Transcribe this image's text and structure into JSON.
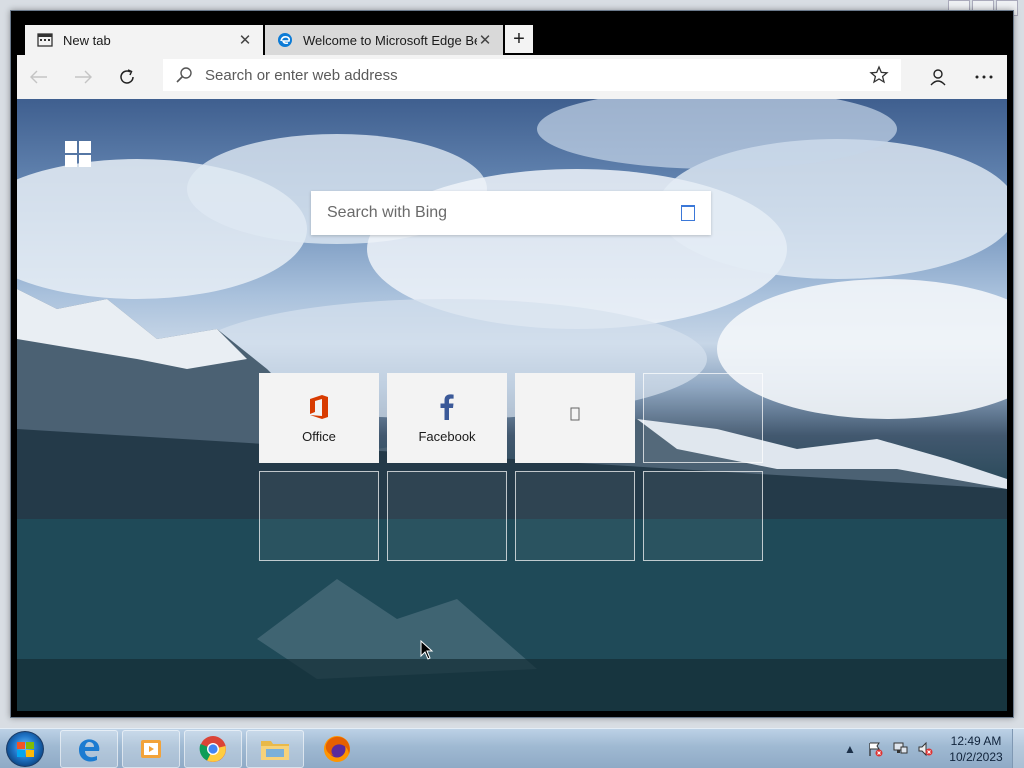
{
  "browser": {
    "tabs": [
      {
        "title": "New tab",
        "icon": "newtab-page-icon",
        "active": true
      },
      {
        "title": "Welcome to Microsoft Edge Beta",
        "icon": "edge-logo-icon",
        "active": false
      }
    ],
    "address_placeholder": "Search or enter web address"
  },
  "new_tab_page": {
    "search_placeholder": "Search with Bing",
    "tiles": [
      {
        "label": "Office",
        "icon": "office-icon"
      },
      {
        "label": "Facebook",
        "icon": "facebook-icon"
      },
      {
        "label": "",
        "icon": "generic-site-icon"
      },
      {
        "label": "",
        "icon": ""
      },
      {
        "label": "",
        "icon": ""
      },
      {
        "label": "",
        "icon": ""
      },
      {
        "label": "",
        "icon": ""
      },
      {
        "label": "",
        "icon": ""
      }
    ]
  },
  "taskbar": {
    "apps": [
      "edge-icon",
      "media-player-icon",
      "chrome-icon",
      "file-explorer-icon",
      "firefox-icon"
    ],
    "clock_time": "12:49 AM",
    "clock_date": "10/2/2023"
  },
  "colors": {
    "office_red": "#d83b01",
    "facebook_blue": "#3b5998",
    "edge_blue": "#0c7bd6"
  }
}
